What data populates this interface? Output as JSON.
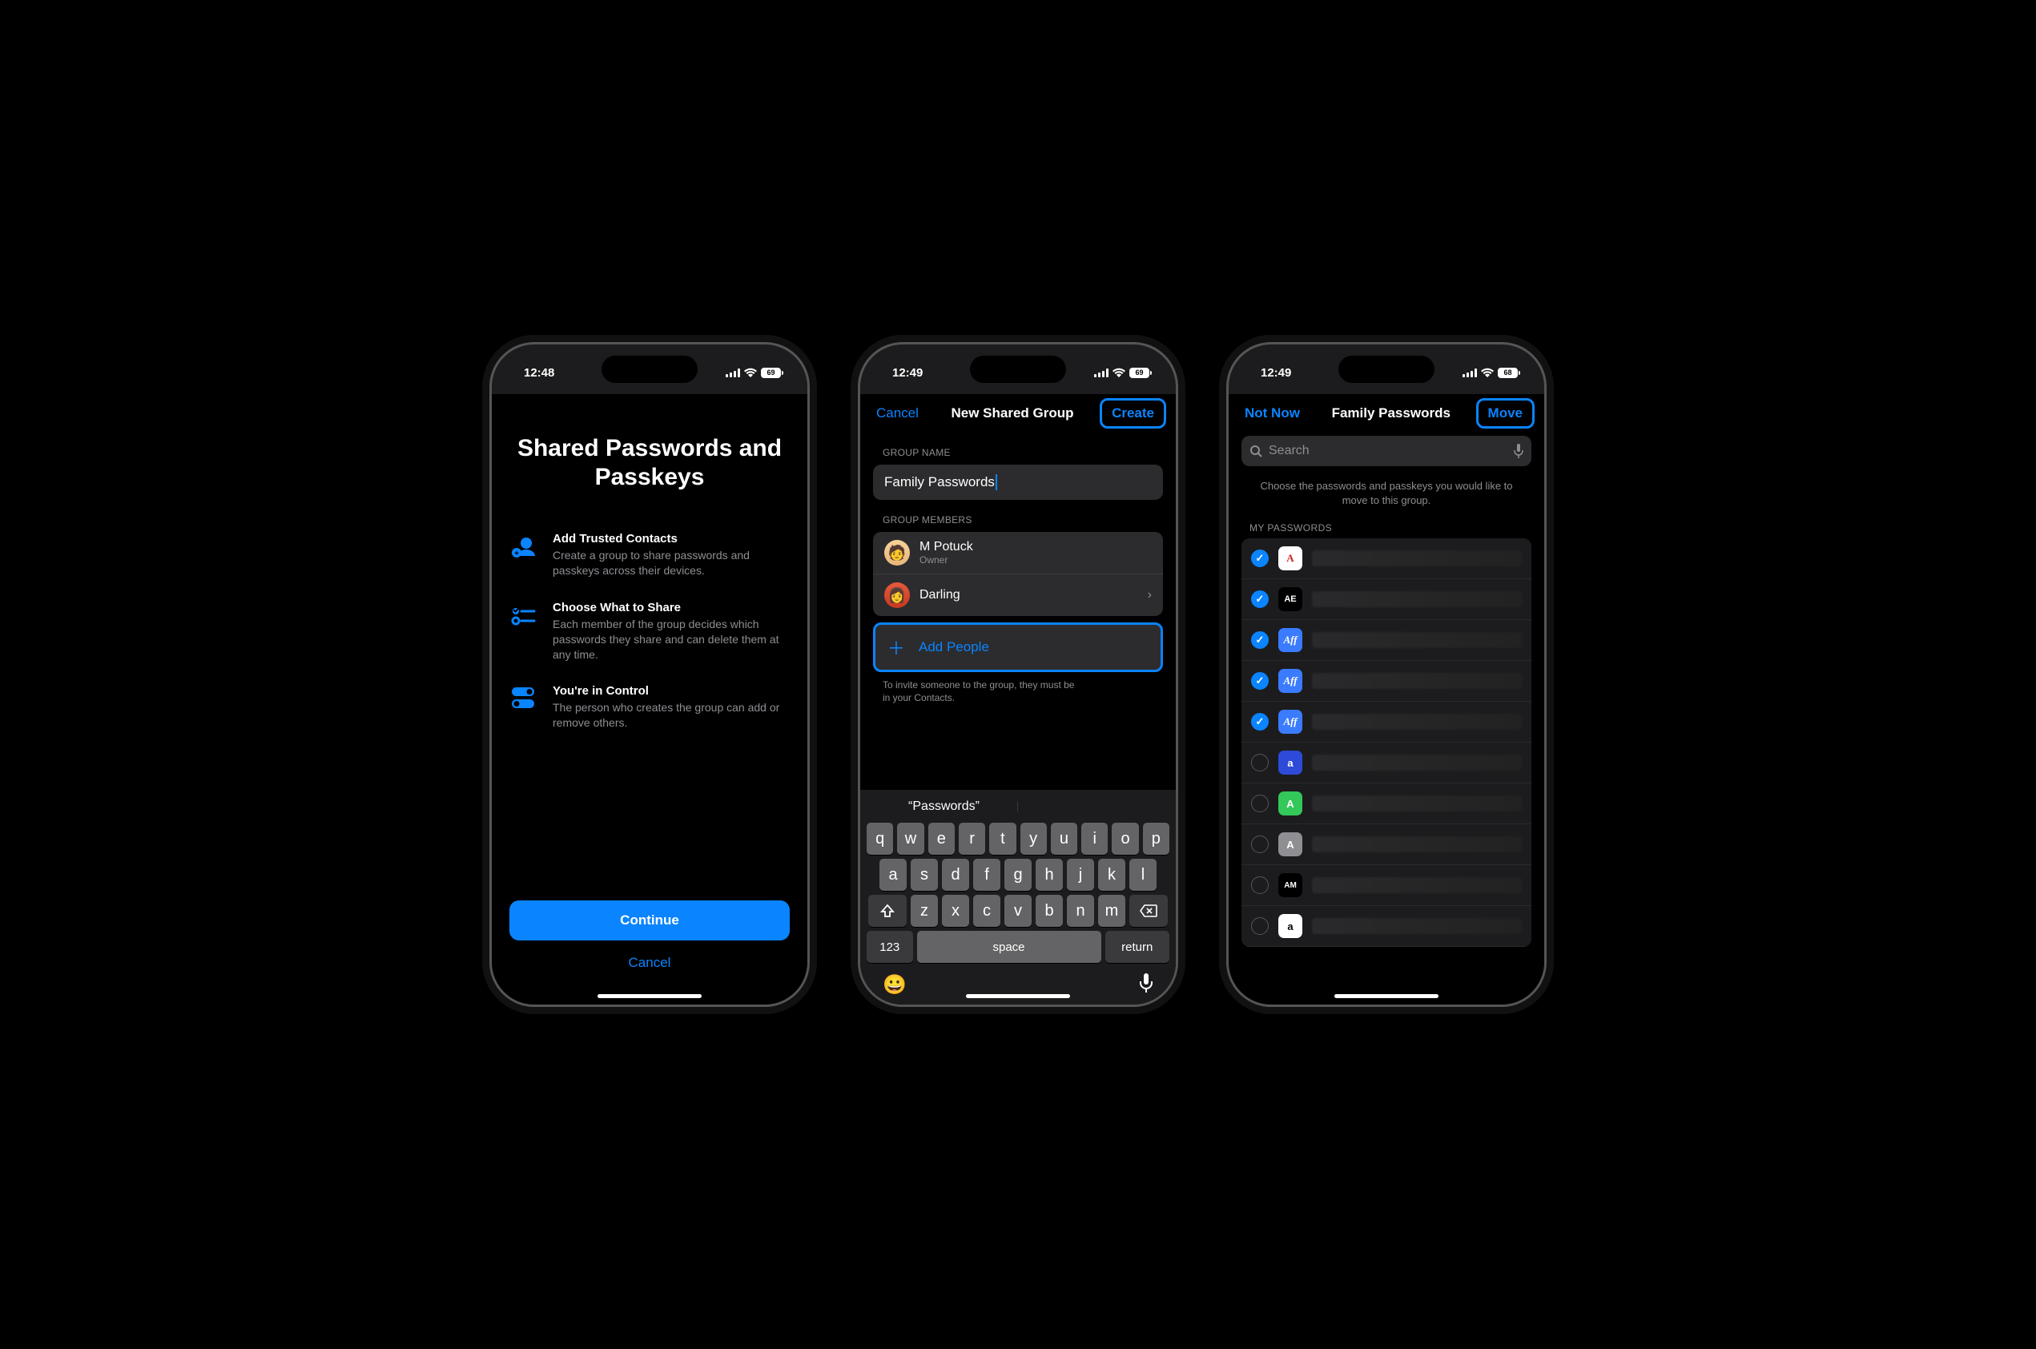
{
  "screen1": {
    "statusTime": "12:48",
    "battery": "69",
    "title": "Shared Passwords and Passkeys",
    "items": [
      {
        "h": "Add Trusted Contacts",
        "p": "Create a group to share passwords and passkeys across their devices."
      },
      {
        "h": "Choose What to Share",
        "p": "Each member of the group decides which passwords they share and can delete them at any time."
      },
      {
        "h": "You're in Control",
        "p": "The person who creates the group can add or remove others."
      }
    ],
    "continue": "Continue",
    "cancel": "Cancel"
  },
  "screen2": {
    "statusTime": "12:49",
    "battery": "69",
    "navCancel": "Cancel",
    "navTitle": "New Shared Group",
    "navCreate": "Create",
    "groupNameLabel": "GROUP NAME",
    "groupNameValue": "Family Passwords",
    "membersLabel": "GROUP MEMBERS",
    "members": [
      {
        "name": "M Potuck",
        "sub": "Owner"
      },
      {
        "name": "Darling",
        "sub": ""
      }
    ],
    "addPeople": "Add People",
    "inviteNote": "To invite someone to the group, they must be in your Contacts.",
    "suggestion": "“Passwords”",
    "keys": {
      "row1": [
        "q",
        "w",
        "e",
        "r",
        "t",
        "y",
        "u",
        "i",
        "o",
        "p"
      ],
      "row2": [
        "a",
        "s",
        "d",
        "f",
        "g",
        "h",
        "j",
        "k",
        "l"
      ],
      "row3": [
        "z",
        "x",
        "c",
        "v",
        "b",
        "n",
        "m"
      ],
      "num": "123",
      "space": "space",
      "ret": "return"
    }
  },
  "screen3": {
    "statusTime": "12:49",
    "battery": "68",
    "navNotNow": "Not Now",
    "navTitle": "Family Passwords",
    "navMove": "Move",
    "searchPlaceholder": "Search",
    "desc": "Choose the passwords and passkeys you would like to move to this group.",
    "listLabel": "MY PASSWORDS",
    "rows": [
      {
        "checked": true,
        "cls": "ic-aa",
        "txt": "A"
      },
      {
        "checked": true,
        "cls": "ic-ae",
        "txt": "AE"
      },
      {
        "checked": true,
        "cls": "ic-aff",
        "txt": "Aff"
      },
      {
        "checked": true,
        "cls": "ic-aff",
        "txt": "Aff"
      },
      {
        "checked": true,
        "cls": "ic-aff",
        "txt": "Aff"
      },
      {
        "checked": false,
        "cls": "ic-a1",
        "txt": "a"
      },
      {
        "checked": false,
        "cls": "ic-a2",
        "txt": "A"
      },
      {
        "checked": false,
        "cls": "ic-a3",
        "txt": "A"
      },
      {
        "checked": false,
        "cls": "ic-am",
        "txt": "AM"
      },
      {
        "checked": false,
        "cls": "ic-amz",
        "txt": "a"
      }
    ]
  }
}
